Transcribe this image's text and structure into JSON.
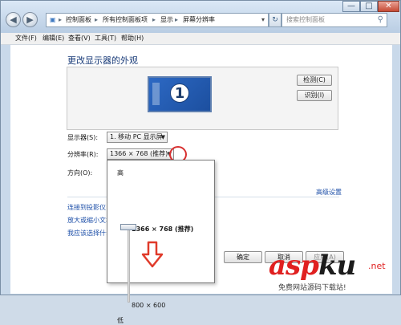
{
  "window": {
    "address": {
      "crumbs": [
        "控制面板",
        "所有控制面板项",
        "显示",
        "屏幕分辨率"
      ],
      "separator": "▸"
    },
    "search_placeholder": "搜索控制面板",
    "controls": {
      "minimize": "—",
      "maximize": "□",
      "close": "✕"
    }
  },
  "menu": [
    "文件(F)",
    "编辑(E)",
    "查看(V)",
    "工具(T)",
    "帮助(H)"
  ],
  "main": {
    "heading": "更改显示器的外观",
    "monitor_number": "1",
    "detect_button": "检测(C)",
    "identify_button": "识别(I)",
    "display_label": "显示器(S):",
    "display_value": "1. 移动 PC 显示屏",
    "resolution_label": "分辨率(R):",
    "resolution_value": "1366 × 768 (推荐)",
    "orientation_label": "方向(O):",
    "advanced_link": "高级设置",
    "links": [
      "连接到投影仪 (",
      "放大或缩小文本",
      "我应该选择什么"
    ],
    "ok": "确定",
    "cancel": "取消",
    "apply": "应用(A)"
  },
  "popup": {
    "high": "高",
    "low": "低",
    "top_option": "1366 × 768 (推荐)",
    "bottom_option": "800 × 600"
  },
  "watermark": {
    "text_a": "asp",
    "text_k": "ku",
    "net": ".net",
    "sub": "免费网站源码下载站!"
  },
  "colors": {
    "accent_red": "#e02020",
    "link_blue": "#1d4fa8",
    "heading_blue": "#1b3d7a"
  }
}
